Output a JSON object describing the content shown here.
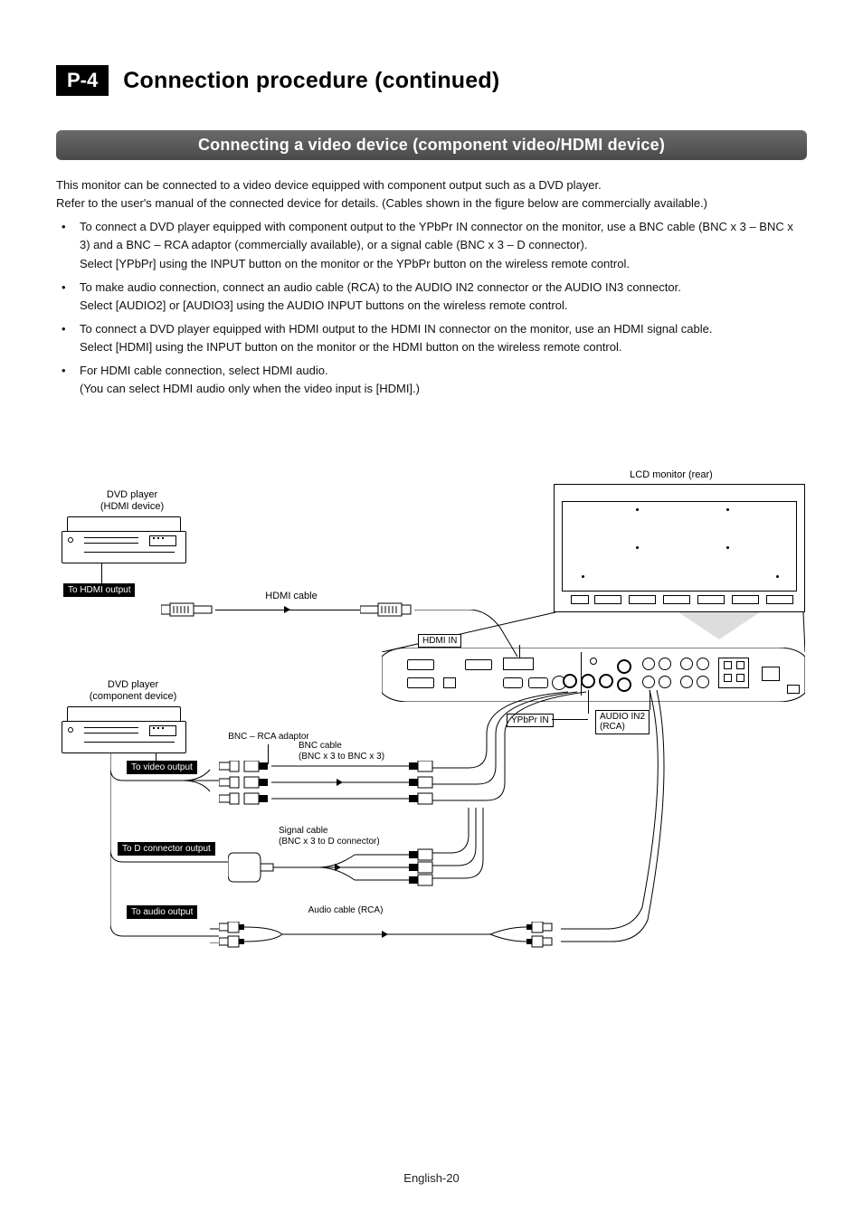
{
  "header": {
    "badge": "P-4",
    "title": "Connection procedure (continued)"
  },
  "section": {
    "title": "Connecting a video device (component video/HDMI device)"
  },
  "intro": {
    "line1": "This monitor can be connected to a video device equipped with component output such as a DVD player.",
    "line2": "Refer to the user's manual of the connected device for details. (Cables shown in the figure below are commercially available.)"
  },
  "bullets": [
    {
      "lines": [
        "To connect a DVD player equipped with component output to the YPbPr IN connector on the monitor, use a BNC cable (BNC x 3 – BNC x 3) and a BNC – RCA adaptor (commercially available), or a signal cable (BNC x 3 – D connector).",
        "Select [YPbPr] using the INPUT button on the monitor or the YPbPr button on the wireless remote control."
      ]
    },
    {
      "lines": [
        "To make audio connection, connect an audio cable (RCA) to the AUDIO IN2 connector or the AUDIO IN3 connector.",
        "Select [AUDIO2] or [AUDIO3] using the AUDIO INPUT buttons on the wireless remote control."
      ]
    },
    {
      "lines": [
        "To connect a DVD player equipped with HDMI output to the HDMI IN connector on the monitor, use an HDMI signal cable.",
        "Select [HDMI] using the INPUT button on the monitor or the HDMI button on the wireless remote control."
      ]
    },
    {
      "lines": [
        "For HDMI cable connection, select HDMI audio.",
        "(You can select HDMI audio only when the video input is [HDMI].)"
      ]
    }
  ],
  "diagram": {
    "lcd_label": "LCD monitor (rear)",
    "dvd_hdmi_label": "DVD player\n(HDMI device)",
    "dvd_comp_label": "DVD player\n(component device)",
    "to_hdmi_output": "To HDMI output",
    "hdmi_cable": "HDMI cable",
    "hdmi_in": "HDMI IN",
    "ypbpr_in": "YPbPr IN",
    "audio_in2": "AUDIO IN2\n(RCA)",
    "bnc_rca_adaptor": "BNC – RCA adaptor",
    "bnc_cable": "BNC cable\n(BNC x 3 to BNC x 3)",
    "signal_cable": "Signal cable\n(BNC x 3 to D connector)",
    "audio_cable": "Audio cable (RCA)",
    "to_video_output": "To video output",
    "to_d_connector_output": "To D connector output",
    "to_audio_output": "To audio output"
  },
  "footer": {
    "page_label": "English-20"
  }
}
